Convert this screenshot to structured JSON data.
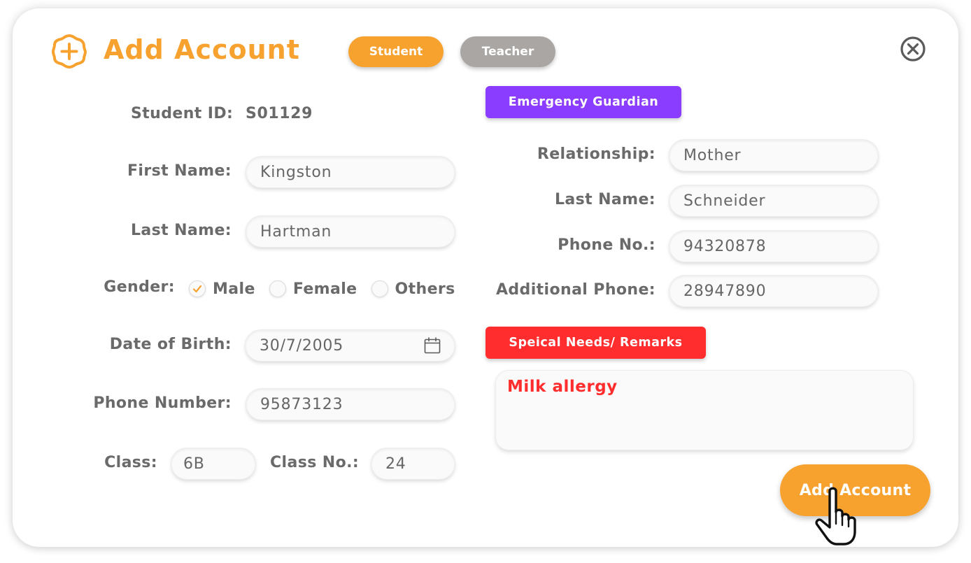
{
  "header": {
    "title": "Add Account",
    "tabs": [
      {
        "label": "Student",
        "active": true
      },
      {
        "label": "Teacher",
        "active": false
      }
    ],
    "icons": {
      "title_icon": "add-circle-icon",
      "close_icon": "close-circle-icon"
    }
  },
  "student": {
    "id_label": "Student ID:",
    "id_value": "S01129",
    "first_name_label": "First Name:",
    "first_name": "Kingston",
    "last_name_label": "Last Name:",
    "last_name": "Hartman",
    "gender_label": "Gender:",
    "gender_options": [
      {
        "label": "Male",
        "checked": true
      },
      {
        "label": "Female",
        "checked": false
      },
      {
        "label": "Others",
        "checked": false
      }
    ],
    "dob_label": "Date of Birth:",
    "dob": "30/7/2005",
    "phone_label": "Phone Number:",
    "phone": "95873123",
    "class_label": "Class:",
    "class": "6B",
    "class_no_label": "Class No.:",
    "class_no": "24"
  },
  "guardian": {
    "section_label": "Emergency Guardian",
    "relationship_label": "Relationship:",
    "relationship": "Mother",
    "last_name_label": "Last Name:",
    "last_name": "Schneider",
    "phone_label": "Phone No.:",
    "phone": "94320878",
    "additional_phone_label": "Additional Phone:",
    "additional_phone": "28947890"
  },
  "remarks": {
    "section_label": "Speical Needs/ Remarks",
    "text": "Milk allergy"
  },
  "actions": {
    "submit_label": "Add Account"
  },
  "colors": {
    "accent": "#f7a12f",
    "inactive": "#a9a6a3",
    "guardian": "#8a3cff",
    "remarks": "#ff2d2d",
    "label": "#6a6a6a"
  }
}
